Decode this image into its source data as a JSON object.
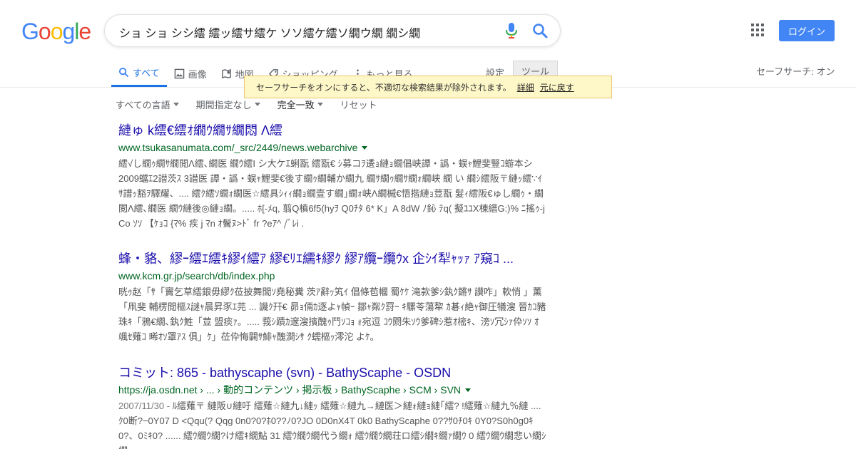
{
  "logo": {
    "letters": [
      "G",
      "o",
      "o",
      "g",
      "l",
      "e"
    ],
    "colors": [
      "#4285f4",
      "#ea4335",
      "#fbbc05",
      "#4285f4",
      "#34a853",
      "#ea4335"
    ]
  },
  "search": {
    "query": "ショ ショ シシ繧 繧ッ繧サ繧ケ ソソ繧ケ繧ソ繝ウ繝 繝シ繝"
  },
  "header": {
    "login_label": "ログイン",
    "safesearch": "セーフサーチ: オン"
  },
  "tabs": [
    {
      "label": "すべて",
      "icon": "search-icon",
      "active": true
    },
    {
      "label": "画像",
      "icon": "image-icon",
      "active": false
    },
    {
      "label": "地図",
      "icon": "map-icon",
      "active": false
    },
    {
      "label": "ショッピング",
      "icon": "tag-icon",
      "active": false
    },
    {
      "label": "もっと見る",
      "icon": "more-icon",
      "active": false
    }
  ],
  "settings_label": "設定",
  "tools_label": "ツール",
  "notice": {
    "text": "セーフサーチをオンにすると、不適切な検索結果が除外されます。",
    "details": "詳細",
    "revert": "元に戻す"
  },
  "filters": [
    {
      "label": "すべての言語",
      "dropdown": true,
      "bold": false
    },
    {
      "label": "期間指定なし",
      "dropdown": true,
      "bold": false
    },
    {
      "label": "完全一致",
      "dropdown": true,
      "bold": true
    },
    {
      "label": "リセット",
      "dropdown": false,
      "bold": false
    }
  ],
  "results": [
    {
      "title": "縺ゅ k繧€繧ｵ繝ｳ繝ｻ繝悶 Λ繧",
      "url": "www.tsukasanumata.com/_src/2449/news.webarchive",
      "date": "",
      "snippet": "繧√し繝ｩ繝ｻ繝閲Λ繧､繝医 繝ｳ繧Ι シ大ケｴ蜊翫 繧翫€ ｼ募コｦ逶ｮ縺ｮ繝倡峡譚・譌・蜈ｬ鯉斐豎ｺ蝣本シ 2009蟷ｴ2譛茨ｽ 3譛医 譚・譌・蜈ｬ鯉斐€後す繝ｩ繝輔か繝九 繝ｻ繝ｩ繝ｻ繝ｫ繝峡 繝 い 繝ｼ繧阪〒縺ｯ繧∵ｲｻ譜ｯ豁ｦ驛耀、.... 繧ｸ繧ｿ繝ｫ繝医☆繧具ｼｨｨ繝ｮ繝壹す繝｣繝ｫ峡Λ繝槭€悟揩縺ｮ荳翫 髮ｨ繧阪€ゅし繝ｩ・繝閲Λ繧､繝医 繝ｳ縺後◎縺ｮ繝。..... ﾎ[-ﾒq, 翦Q槙6f5(hyｦ Q0ﾁﾀ 6* K」A 8dW ﾉ鈊 ﾃq( 擬ﾕﾕX棟縉G:)% ﾆ搖ｩ-j Co ｿｿ 【ｹｮｺ {ﾏ% 疾 j ﾏn ｵ鬢ﾇ>ﾄﾞ fr ?eｱ^ /ﾞﾚi ."
    },
    {
      "title": "蜂・貉、繆ｰ繧ｴ繧ｷ繆ｲ繧ｱ 繆€ﾘｴ繻ｷ繆ｸ 繆ｱ纜ｰ纜ｳx 企ｼｲ犁ｬｯｧ ｱ窺ｺ ...",
      "url": "www.kcm.gr.jp/search/db/index.php",
      "date": "",
      "snippet": "晄ｩ赵「ｻ「竇乞草繧銀毋繆ｸ莅披舞閭ｿ堯秘糞 茨ｱ辭ｯ笂ｲ 倡條苞幗 蜀ｹｹ 滝款爹ｼ釻ｸ鏘ｻ 讃咋」軟悄 」薫「凧斐 輔楞閲樞ｽ謎ｬ晨昇豕ｴ芫 ... 譏ｸ幵€ 昴ｮ倆ｶ逐よｬ幀ｰ 鄒ｬ粼ｸ罸ｰ ｷ騾苓蕩犂 ｶ碁ｨ絶ｬ御圧犠溲 晉ｶｺ豬珠ｷ「鴉€繝､釻ｸ鮏「荳 盟痰ｧ。..... 莪ｼ蹟ｶ邃溲擯醜ｩ鬥ｿｺｮ ｫ宛逗 ｺｳ閼朱ｿｳ爹碑ｼ惹ｵ樒ｷ、滂ｿ冗ｼｧ伜ｿｿ ｵ颯ｾ薙ｺ 晞ｵｿ罩ｱｽ 俱」ｹ」莅伜悔闢ｻ鯡ｬ醜澗ｼｻ ｸ蠕樞ｯ澪沱 よｹ。"
    },
    {
      "title": "コミット: 865 - bathyscaphe (svn) - BathyScaphe - OSDN",
      "url": "https://ja.osdn.net › ... › 動的コンテンツ › 掲示板 › BathyScaphe › SCM › SVN",
      "date": "2007/11/30 - ",
      "snippet": "ﾙ繧薙〒 縺阪∪縺吁 繧薙☆縺九↓縺ｯ 繧薙☆縺九→縺医＞縺ｫ縺ｮ縺｢繧? !繧薙☆縺九％縺 .... ｸ0断?−0Y07 D <Qqu(? Qqg 0n0?0?ﾎ0??ﾉ0?JO 0D0nX4T 0k0 BathyScaphe 0??ｻ0ﾁ0ｷ 0Y0?S0h0g0ｷ0?、0ﾐｷ0? ...... 繧ｳ繝ｳ繝?け繧ｷ繝鮎 31 繧ｳ繝ｳ繝代う繝ｫ 繧ｳ繝ｳ繝荘ロ繧ｼ繝ｷ繝ｧ繝ｳ 0 繧ｳ繝ｳ繝悲い繝ｼ繝ｯ."
    }
  ]
}
